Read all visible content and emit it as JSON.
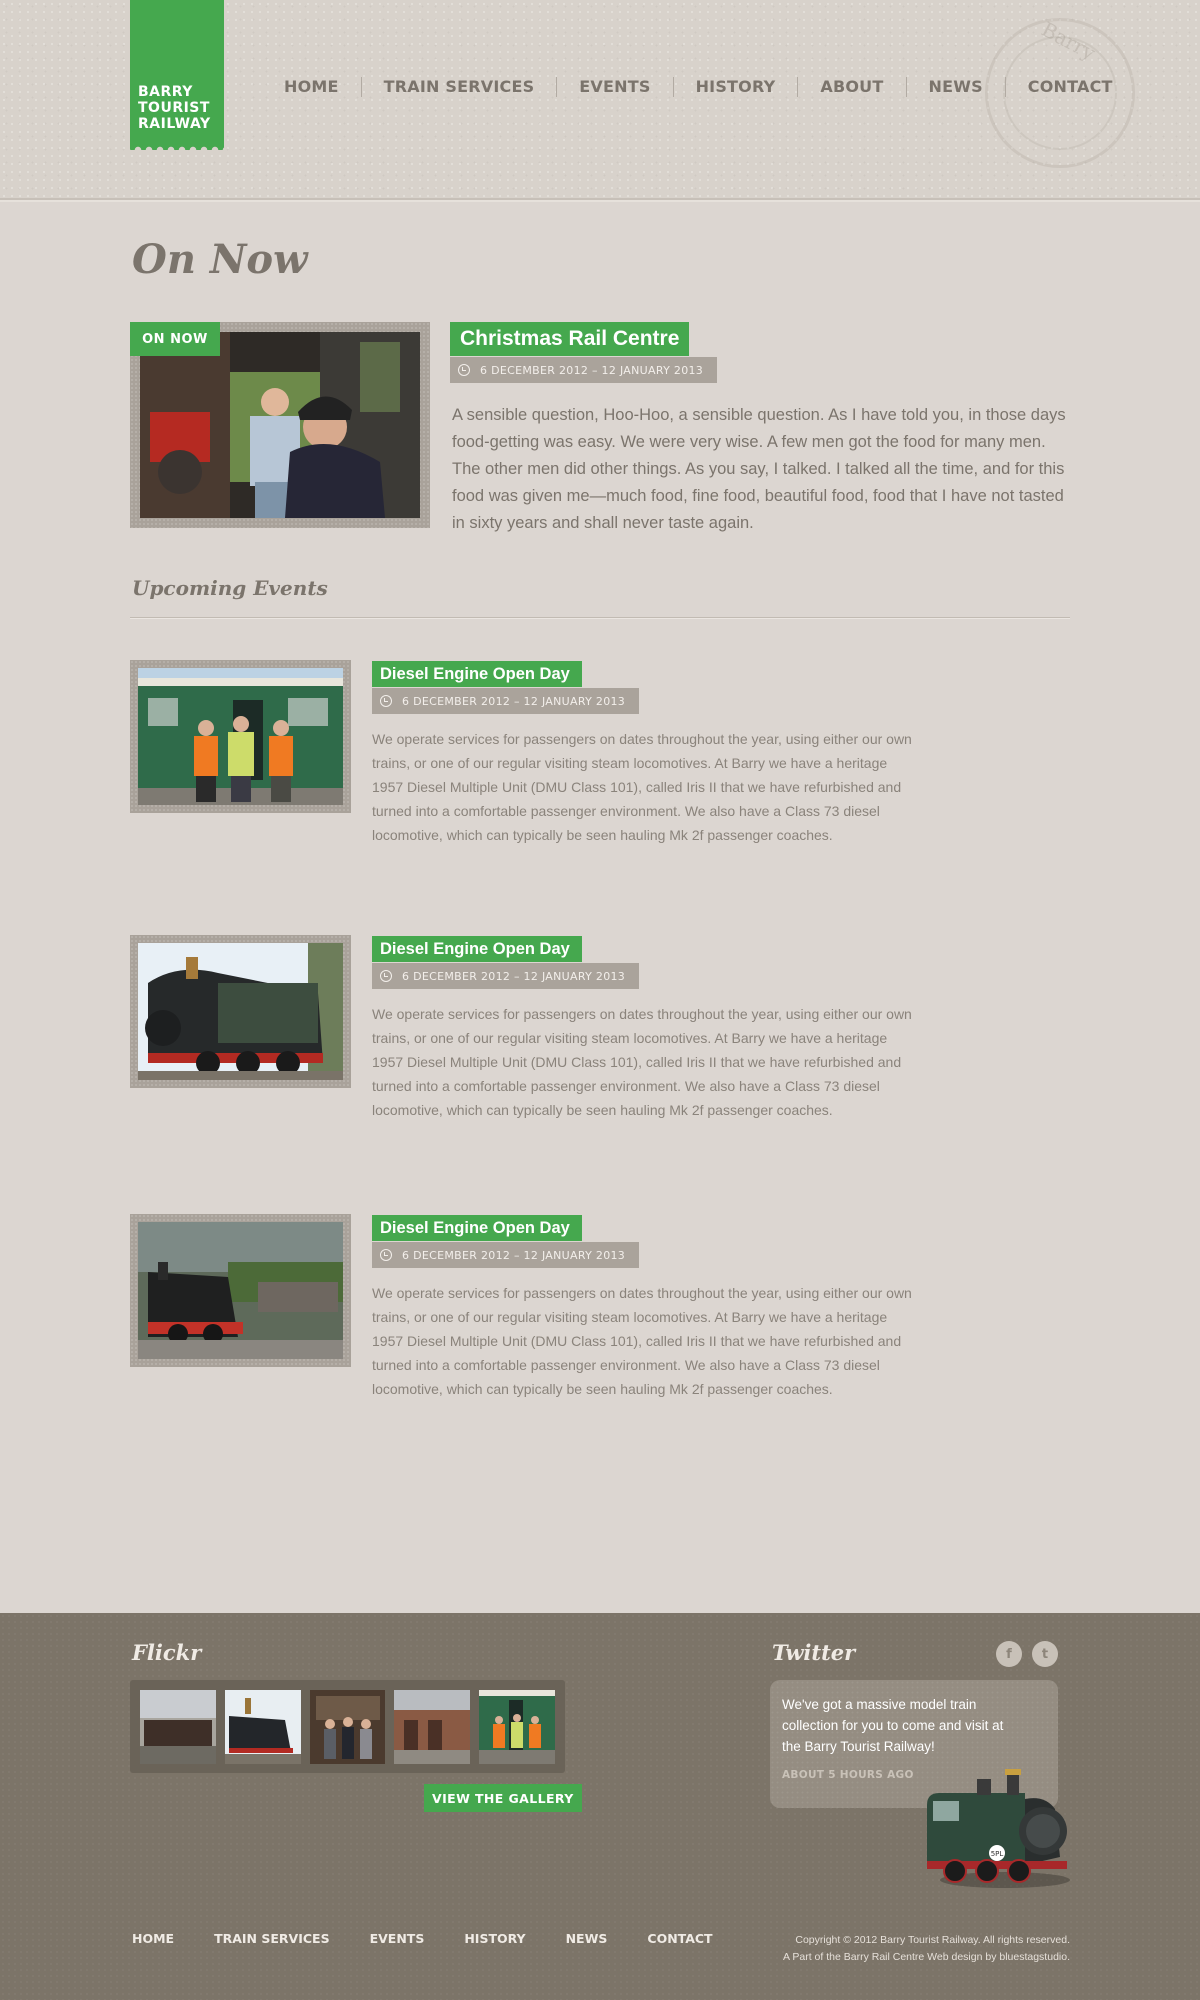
{
  "logo": {
    "lines": [
      "BARRY",
      "TOURIST",
      "RAILWAY"
    ],
    "brand_color": "#45a84e"
  },
  "nav": {
    "items": [
      "HOME",
      "TRAIN SERVICES",
      "EVENTS",
      "HISTORY",
      "ABOUT",
      "NEWS",
      "CONTACT"
    ]
  },
  "stamp_text": "Barry",
  "on_now": {
    "heading": "On Now",
    "badge": "ON NOW",
    "title": "Christmas Rail Centre",
    "date": "6 DECEMBER 2012 – 12 JANUARY 2013",
    "body": "A sensible question, Hoo-Hoo, a sensible question. As I have told you, in those days food-getting was easy. We were very wise. A few men got the food for many men. The other men did other things. As you say, I talked. I talked all the time, and for this food was given me—much food, fine food, beautiful food, food that I have not tasted in sixty years and shall never taste again."
  },
  "upcoming": {
    "heading": "Upcoming Events",
    "events": [
      {
        "title": "Diesel Engine Open Day",
        "date": "6 DECEMBER 2012 – 12 JANUARY 2013",
        "body": "We operate services for passengers on dates throughout the year, using either our own trains, or one of our regular visiting steam locomotives.  At Barry we have a heritage 1957 Diesel Multiple Unit (DMU Class 101), called Iris II that we have refurbished and turned into a comfortable passenger environment. We also have a Class 73 diesel locomotive, which can typically be seen hauling Mk 2f passenger coaches."
      },
      {
        "title": "Diesel Engine Open Day",
        "date": "6 DECEMBER 2012 – 12 JANUARY 2013",
        "body": "We operate services for passengers on dates throughout the year, using either our own trains, or one of our regular visiting steam locomotives.  At Barry we have a heritage 1957 Diesel Multiple Unit (DMU Class 101), called Iris II that we have refurbished and turned into a comfortable passenger environment. We also have a Class 73 diesel locomotive, which can typically be seen hauling Mk 2f passenger coaches."
      },
      {
        "title": "Diesel Engine Open Day",
        "date": "6 DECEMBER 2012 – 12 JANUARY 2013",
        "body": "We operate services for passengers on dates throughout the year, using either our own trains, or one of our regular visiting steam locomotives.  At Barry we have a heritage 1957 Diesel Multiple Unit (DMU Class 101), called Iris II that we have refurbished and turned into a comfortable passenger environment. We also have a Class 73 diesel locomotive, which can typically be seen hauling Mk 2f passenger coaches."
      }
    ]
  },
  "footer": {
    "flickr_heading": "Flickr",
    "gallery_button": "VIEW THE GALLERY",
    "twitter_heading": "Twitter",
    "social_icons": [
      "facebook-icon",
      "twitter-icon"
    ],
    "tweet": {
      "text": "We've got a massive model train collection for you to come and visit at the Barry Tourist Railway!",
      "time": "ABOUT 5 HOURS AGO"
    },
    "nav": [
      "HOME",
      "TRAIN SERVICES",
      "EVENTS",
      "HISTORY",
      "NEWS",
      "CONTACT"
    ],
    "copyright_line1": "Copyright © 2012 Barry Tourist Railway. All rights reserved.",
    "copyright_line2": "A Part of the Barry Rail Centre Web design by bluestagstudio."
  }
}
